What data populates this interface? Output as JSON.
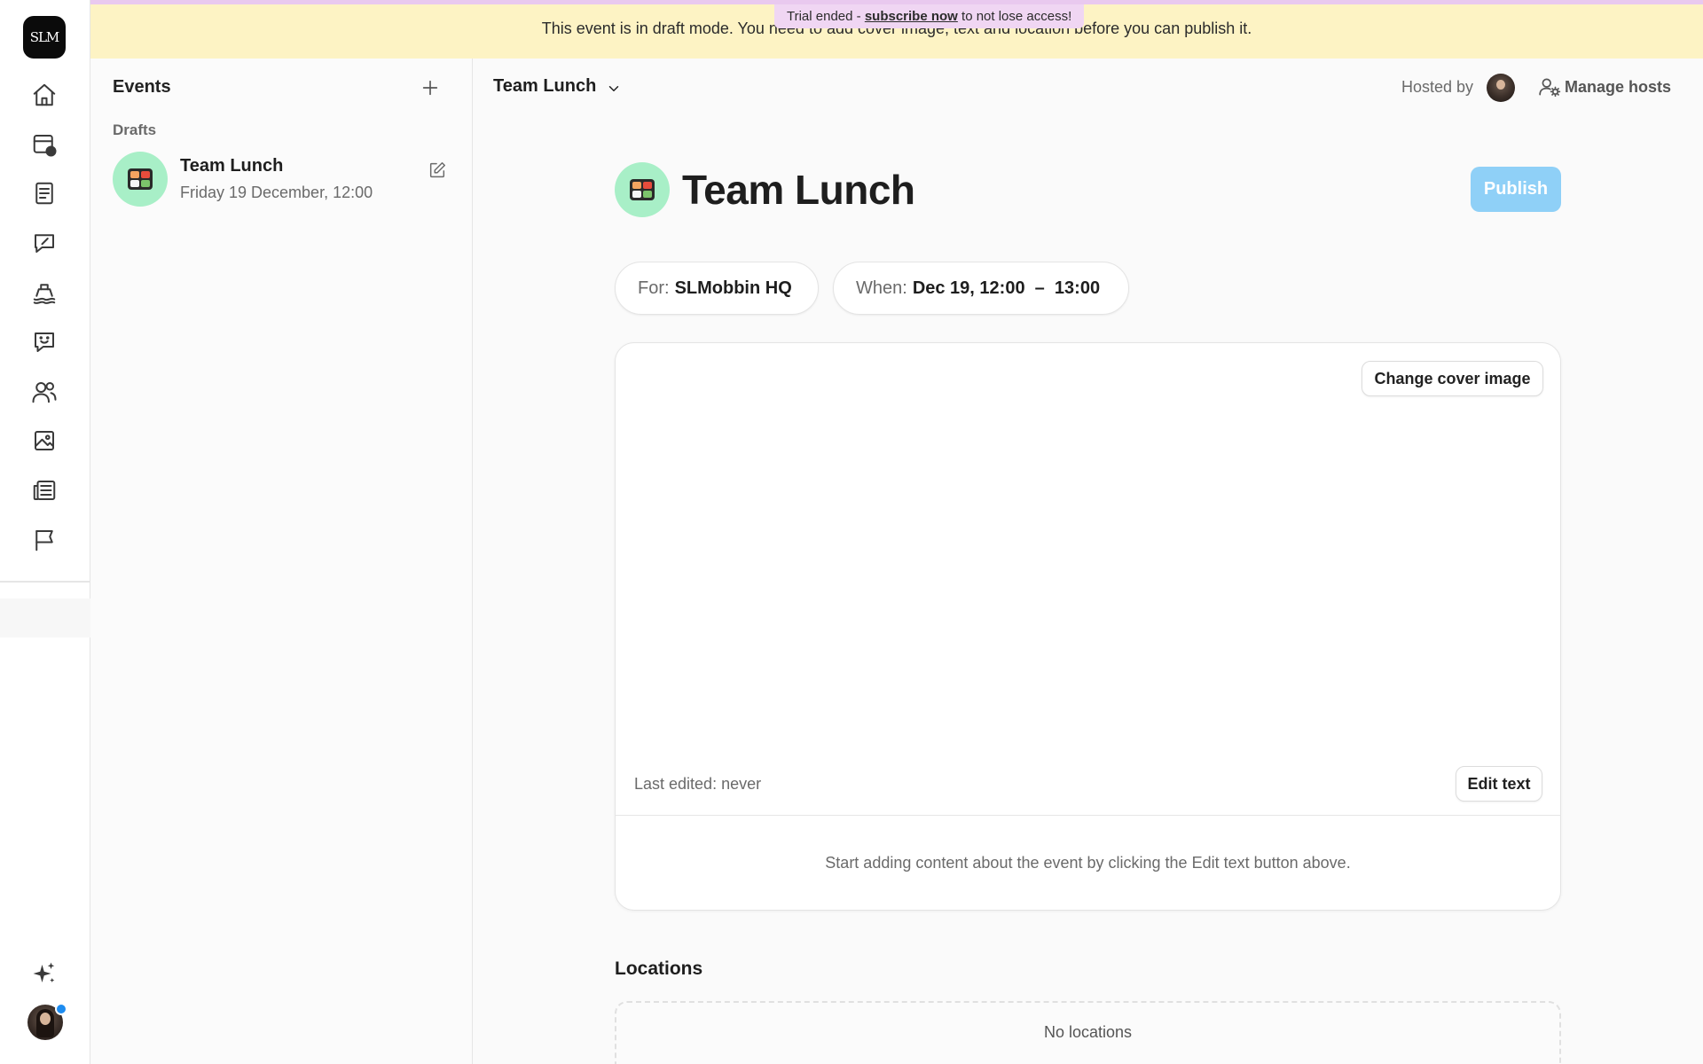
{
  "app": {
    "logo_text": "SLM"
  },
  "rail": {
    "items": [
      {
        "name": "home-icon"
      },
      {
        "name": "calendar-clock-icon"
      },
      {
        "name": "book-icon"
      },
      {
        "name": "chat-edit-icon"
      },
      {
        "name": "ship-icon"
      },
      {
        "name": "chat-smile-icon"
      },
      {
        "name": "users-icon"
      },
      {
        "name": "image-icon"
      },
      {
        "name": "newspaper-icon"
      },
      {
        "name": "flag-icon"
      }
    ],
    "bottom": [
      {
        "name": "sparkles-icon"
      },
      {
        "name": "user-avatar"
      }
    ],
    "notification_color": "#1d8cf0"
  },
  "banner": {
    "trial_prefix": "Trial ended - ",
    "trial_link": "subscribe now",
    "trial_suffix": " to not lose access!",
    "message": "This event is in draft mode. You need to add cover image, text and location before you can publish it.",
    "background": "#fdf3c4"
  },
  "events_panel": {
    "title": "Events",
    "section_label": "Drafts",
    "items": [
      {
        "name": "Team Lunch",
        "date": "Friday 19 December, 12:00",
        "icon": "bento-box-icon"
      }
    ]
  },
  "header": {
    "title": "Team Lunch",
    "hosted_by_label": "Hosted by",
    "manage_hosts_label": "Manage hosts"
  },
  "event": {
    "title": "Team Lunch",
    "publish_label": "Publish",
    "for_label": "For:",
    "for_value": "SLMobbin HQ",
    "when_label": "When:",
    "when_value": "Dec 19, 12:00  –  13:00",
    "change_cover_label": "Change cover image",
    "last_edited": "Last edited: never",
    "edit_text_label": "Edit text",
    "content_hint": "Start adding content about the event by clicking the Edit text button above.",
    "accent_publish_color": "#8fd0f7"
  },
  "locations": {
    "title": "Locations",
    "empty_text": "No locations"
  }
}
